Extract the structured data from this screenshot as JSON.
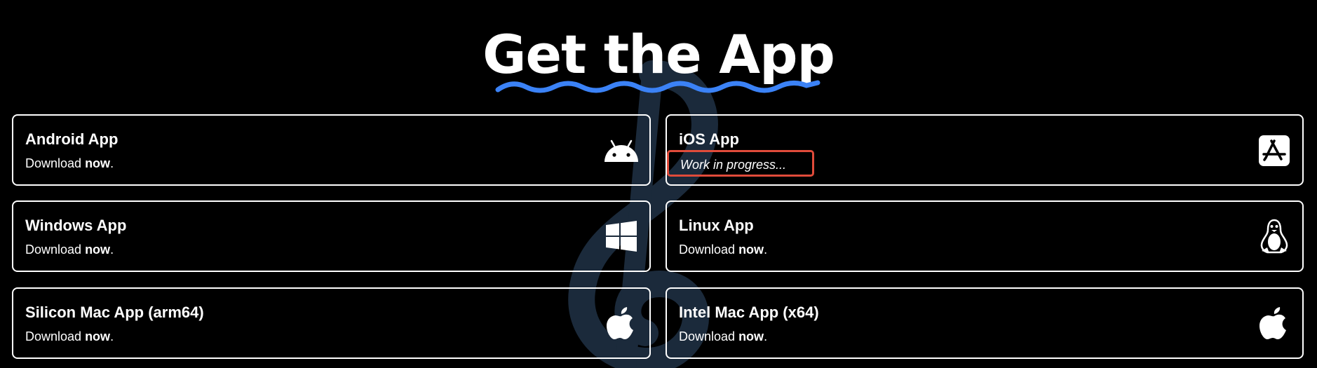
{
  "heading": {
    "title": "Get the App"
  },
  "colors": {
    "background": "#000000",
    "text": "#ffffff",
    "accent_squiggle": "#3b82f6",
    "highlight_box": "#e04b3a",
    "watermark": "#1b2a3b"
  },
  "cards": [
    {
      "title": "Android App",
      "sub_prefix": "Download ",
      "sub_bold": "now",
      "sub_suffix": ".",
      "icon": "android-icon"
    },
    {
      "title": "iOS App",
      "status": "Work in progress...",
      "icon": "app-store-icon"
    },
    {
      "title": "Windows App",
      "sub_prefix": "Download ",
      "sub_bold": "now",
      "sub_suffix": ".",
      "icon": "windows-icon"
    },
    {
      "title": "Linux App",
      "sub_prefix": "Download ",
      "sub_bold": "now",
      "sub_suffix": ".",
      "icon": "linux-tux-icon"
    },
    {
      "title": "Silicon Mac App (arm64)",
      "sub_prefix": "Download ",
      "sub_bold": "now",
      "sub_suffix": ".",
      "icon": "apple-icon"
    },
    {
      "title": "Intel Mac App (x64)",
      "sub_prefix": "Download ",
      "sub_bold": "now",
      "sub_suffix": ".",
      "icon": "apple-icon"
    }
  ]
}
